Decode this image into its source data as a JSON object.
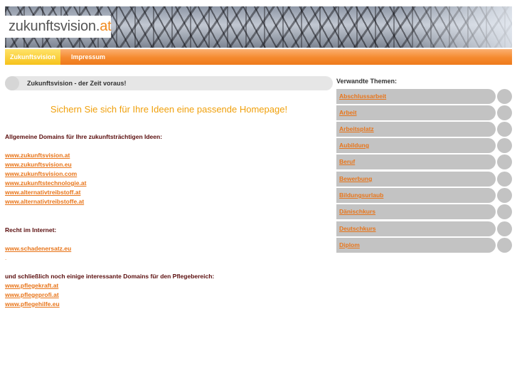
{
  "header": {
    "logo_main": "zukunftsvision.",
    "logo_tld": "at"
  },
  "nav": {
    "items": [
      {
        "label": "Zukunftsvision"
      },
      {
        "label": "Impressum"
      }
    ]
  },
  "main": {
    "title": "Zukunftsvision - der Zeit voraus!",
    "headline": "Sichern Sie sich für Ihre Ideen eine passende Homepage!",
    "general_heading": "Allgemeine Domains für Ihre zukunftsträchtigen Ideen:",
    "general_links": [
      "www.zukunftsvision.at",
      "www.zukunftsvision.eu",
      "www.zukunftsvision.com",
      "www.zukunftstechnologie.at",
      "www.alternativtreibstoff.at",
      "www.alternativtreibstoffe.at"
    ],
    "law_heading": "Recht im Internet:",
    "law_links": [
      "www.schadenersatz.eu"
    ],
    "care_heading": "und schließlich  noch einige interessante Domains für den Pflegebereich:",
    "care_links": [
      "www.pflegekraft.at",
      "www.pflegeprofi.at",
      "www.pflegehilfe.eu"
    ]
  },
  "sidebar": {
    "title": "Verwandte Themen:",
    "topics": [
      "Abschlussarbeit",
      "Arbeit",
      "Arbeitsplatz",
      "Aubildung",
      "Beruf",
      "Bewerbung",
      "Bildungsurlaub",
      "Dänischkurs",
      "Deutschkurs",
      "Diplom"
    ]
  },
  "colors": {
    "accent": "#f08a1e",
    "headline": "#f0a00c",
    "text": "#5a0d0d",
    "link": "#e8751a"
  }
}
